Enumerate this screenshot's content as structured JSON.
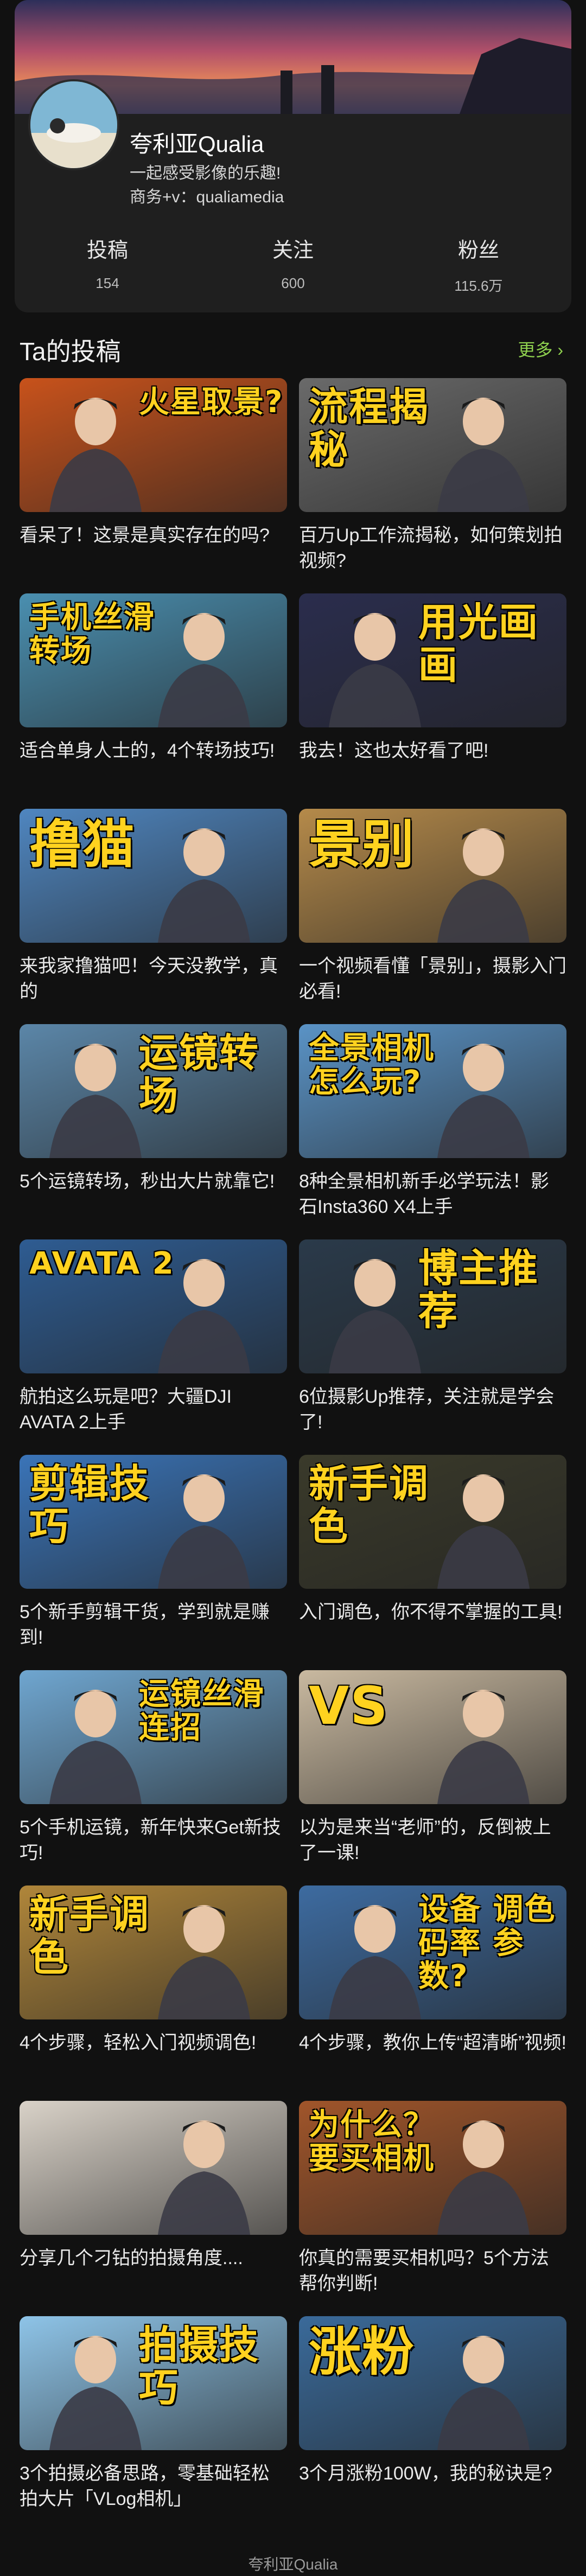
{
  "profile": {
    "name": "夸利亚Qualia",
    "bio_line1": "一起感受影像的乐趣!",
    "bio_line2": "商务+v：qualiamedia",
    "stats": [
      {
        "label": "投稿",
        "value": "154"
      },
      {
        "label": "关注",
        "value": "600"
      },
      {
        "label": "粉丝",
        "value": "115.6万"
      }
    ]
  },
  "section": {
    "title": "Ta的投稿",
    "more": "更多 ›"
  },
  "videos": [
    {
      "title": "看呆了！这景是真实存在的吗?",
      "thumb_text": "火星取景?",
      "bg": "#c8521b"
    },
    {
      "title": "百万Up工作流揭秘，如何策划拍视频?",
      "thumb_text": "流程揭秘",
      "bg": "#6a6a6a"
    },
    {
      "title": "适合单身人士的，4个转场技巧!",
      "thumb_text": "手机丝滑转场",
      "bg": "#4a8fb0"
    },
    {
      "title": "我去！这也太好看了吧!",
      "thumb_text": "用光画画",
      "bg": "#2a2d4d"
    },
    {
      "title": "来我家撸猫吧！今天没教学，真的",
      "thumb_text": "撸猫",
      "bg": "#4f86c0"
    },
    {
      "title": "一个视频看懂「景别」，摄影入门必看!",
      "thumb_text": "景别",
      "bg": "#b58a4a"
    },
    {
      "title": "5个运镜转场，秒出大片就靠它!",
      "thumb_text": "运镜转场",
      "bg": "#5b86a8"
    },
    {
      "title": "8种全景相机新手必学玩法！影石Insta360 X4上手",
      "thumb_text": "全景相机怎么玩?",
      "bg": "#5a93c6"
    },
    {
      "title": "航拍这么玩是吧？大疆DJI AVATA 2上手",
      "thumb_text": "AVATA 2",
      "bg": "#2e5c92"
    },
    {
      "title": "6位摄影Up推荐，关注就是学会了!",
      "thumb_text": "博主推荐",
      "bg": "#2a3a4a"
    },
    {
      "title": "5个新手剪辑干货，学到就是赚到!",
      "thumb_text": "剪辑技巧",
      "bg": "#3a74b8"
    },
    {
      "title": "入门调色，你不得不掌握的工具!",
      "thumb_text": "新手调色",
      "bg": "#3a3a2a"
    },
    {
      "title": "5个手机运镜，新年快来Get新技巧!",
      "thumb_text": "运镜丝滑连招",
      "bg": "#6fa6d0"
    },
    {
      "title": "以为是来当“老师”的，反倒被上了一课!",
      "thumb_text": "VS",
      "bg": "#c9b9a0"
    },
    {
      "title": "4个步骤，轻松入门视频调色!",
      "thumb_text": "新手调色",
      "bg": "#b0863a"
    },
    {
      "title": "4个步骤，教你上传“超清晰”视频!",
      "thumb_text": "设备 调色 码率 参数?",
      "bg": "#3d6ba0"
    },
    {
      "title": "分享几个刁钻的拍摄角度....",
      "thumb_text": "",
      "bg": "#d9d2c8"
    },
    {
      "title": "你真的需要买相机吗？5个方法帮你判断!",
      "thumb_text": "为什么？要买相机",
      "bg": "#a0552a"
    },
    {
      "title": "3个拍摄必备思路，零基础轻松拍大片「VLog相机」",
      "thumb_text": "拍摄技巧",
      "bg": "#8ec4e8"
    },
    {
      "title": "3个月涨粉100W，我的秘诀是?",
      "thumb_text": "涨粉",
      "bg": "#3a6a9a"
    }
  ],
  "footer": "夸利亚Qualia",
  "colors": {
    "accent": "#8fd14f",
    "page_bg": "#111111",
    "card_bg": "#1f1f1f",
    "thumb_text": "#ffd21f"
  }
}
